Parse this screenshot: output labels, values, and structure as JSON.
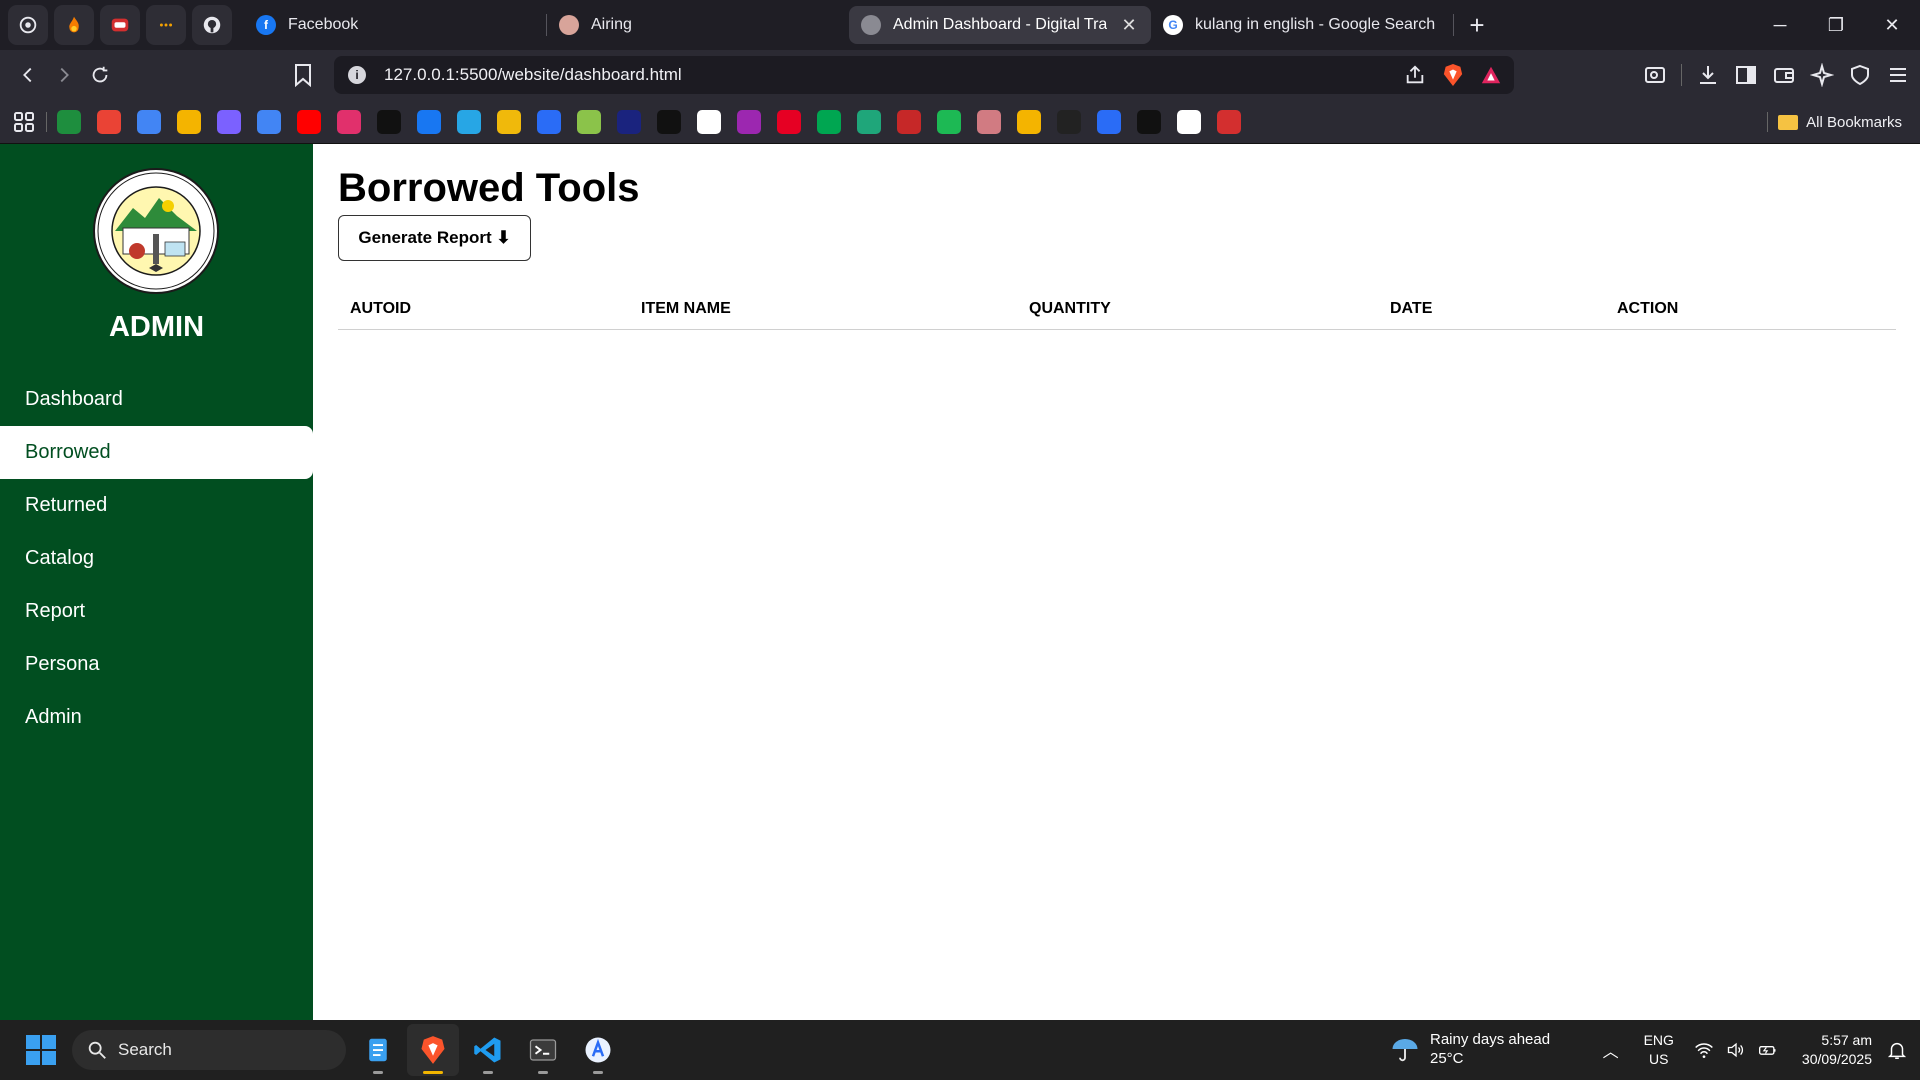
{
  "browser": {
    "pinned_tabs": [
      "chatgpt-icon",
      "fire-icon",
      "rectangle-app-icon",
      "dots-icon",
      "github-icon"
    ],
    "tabs": [
      {
        "title": "Facebook",
        "icon": "facebook-icon",
        "active": false
      },
      {
        "title": "Airing",
        "icon": "anime-avatar-icon",
        "active": false
      },
      {
        "title": "Admin Dashboard - Digital Track",
        "icon": "globe-icon",
        "active": true
      },
      {
        "title": "kulang in english - Google Search",
        "icon": "google-icon",
        "active": false
      }
    ],
    "close_symbol": "✕",
    "new_tab_symbol": "+",
    "window_controls": {
      "minimize": "─",
      "restore": "❐",
      "close": "✕"
    },
    "url": "127.0.0.1:5500/website/dashboard.html",
    "all_bookmarks_label": "All Bookmarks",
    "bookmark_colors": [
      "#1e8e3e",
      "#ea4335",
      "#4285f4",
      "#f4b400",
      "#7b61ff",
      "#4285f4",
      "#ff0000",
      "#e1306c",
      "#111111",
      "#1877f2",
      "#27a6e5",
      "#f0b90b",
      "#2a6cf6",
      "#8bc34a",
      "#1a237e",
      "#111111",
      "#ffffff",
      "#9c27b0",
      "#e60023",
      "#00a651",
      "#1fa67a",
      "#c62828",
      "#1db954",
      "#d17b82",
      "#f4b400",
      "#222222",
      "#2a6cf6",
      "#111111",
      "#ffffff",
      "#d32f2f"
    ]
  },
  "page": {
    "sidebar": {
      "title": "ADMIN",
      "logo_text": "SOUTHERN LUZON STATE UNIVERSITY LUCENA CAMPUS LUCENA CITY",
      "nav_items": [
        "Dashboard",
        "Borrowed",
        "Returned",
        "Catalog",
        "Report",
        "Persona",
        "Admin"
      ],
      "active_item": "Borrowed"
    },
    "main": {
      "title": "Borrowed Tools",
      "generate_button": "Generate Report ⬇",
      "table_headers": [
        "AUTOID",
        "ITEM NAME",
        "QUANTITY",
        "DATE",
        "ACTION"
      ],
      "rows": []
    },
    "colors": {
      "sidebar_green": "#014e20",
      "background": "#ffffff"
    }
  },
  "taskbar": {
    "search_label": "Search",
    "weather": {
      "line1": "Rainy days ahead",
      "line2": "25°C"
    },
    "language": {
      "line1": "ENG",
      "line2": "US"
    },
    "clock": {
      "time": "5:57 am",
      "date": "30/09/2025"
    },
    "apps": [
      "file-explorer-icon",
      "brave-icon",
      "vscode-icon",
      "terminal-icon",
      "app-store-icon"
    ]
  }
}
